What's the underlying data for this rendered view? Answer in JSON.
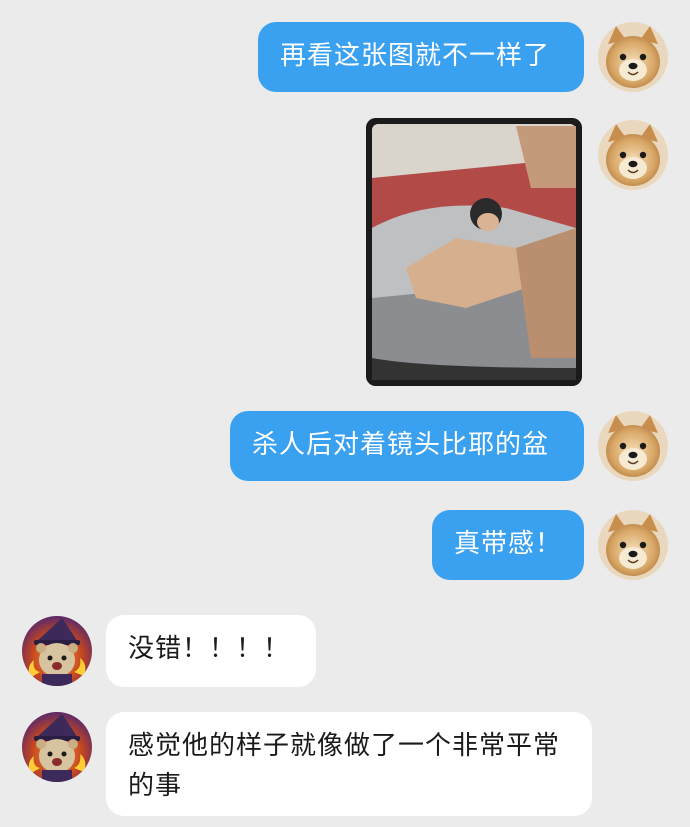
{
  "conversation": {
    "messages": [
      {
        "sender": "me",
        "type": "text",
        "text": "再看这张图就不一样了"
      },
      {
        "sender": "me",
        "type": "image",
        "description_icon": "photo-icon"
      },
      {
        "sender": "me",
        "type": "text",
        "text": "杀人后对着镜头比耶的盆"
      },
      {
        "sender": "me",
        "type": "text",
        "text": "真带感！"
      },
      {
        "sender": "other",
        "type": "text",
        "text": "没错！！！！"
      },
      {
        "sender": "other",
        "type": "text",
        "text": "感觉他的样子就像做了一个非常平常的事"
      }
    ]
  },
  "colors": {
    "background": "#ebebeb",
    "outgoing_bubble": "#3aa0f0",
    "incoming_bubble": "#ffffff",
    "incoming_text": "#1a1a1a"
  },
  "avatars": {
    "me": "shiba-dog-avatar-icon",
    "other": "wizard-bear-avatar-icon"
  }
}
